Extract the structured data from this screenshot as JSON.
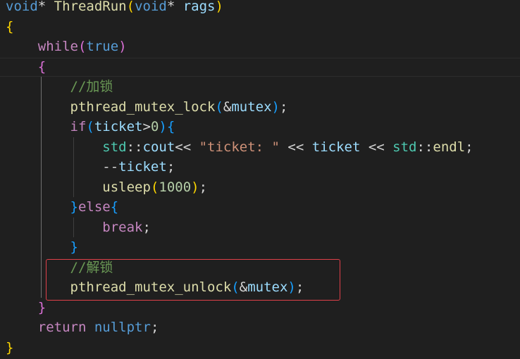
{
  "lines": [
    {
      "tokens": [
        {
          "t": "void",
          "c": "kw-type"
        },
        {
          "t": "* ",
          "c": "plain"
        },
        {
          "t": "ThreadRun",
          "c": "fn"
        },
        {
          "t": "(",
          "c": "b1"
        },
        {
          "t": "void",
          "c": "kw-type"
        },
        {
          "t": "* ",
          "c": "plain"
        },
        {
          "t": "rags",
          "c": "var"
        },
        {
          "t": ")",
          "c": "b1"
        }
      ]
    },
    {
      "tokens": [
        {
          "t": "{",
          "c": "b1"
        }
      ]
    },
    {
      "tokens": [
        {
          "t": "    ",
          "c": "plain"
        },
        {
          "t": "while",
          "c": "kw-ctrl"
        },
        {
          "t": "(",
          "c": "b2"
        },
        {
          "t": "true",
          "c": "kw-type"
        },
        {
          "t": ")",
          "c": "b2"
        }
      ]
    },
    {
      "tokens": [
        {
          "t": "    ",
          "c": "plain"
        },
        {
          "t": "{",
          "c": "b2"
        }
      ]
    },
    {
      "tokens": [
        {
          "t": "        ",
          "c": "plain"
        },
        {
          "t": "//加锁",
          "c": "cmt"
        }
      ]
    },
    {
      "tokens": [
        {
          "t": "        ",
          "c": "plain"
        },
        {
          "t": "pthread_mutex_lock",
          "c": "fn"
        },
        {
          "t": "(",
          "c": "b3"
        },
        {
          "t": "&",
          "c": "plain"
        },
        {
          "t": "mutex",
          "c": "var"
        },
        {
          "t": ")",
          "c": "b3"
        },
        {
          "t": ";",
          "c": "plain"
        }
      ]
    },
    {
      "tokens": [
        {
          "t": "        ",
          "c": "plain"
        },
        {
          "t": "if",
          "c": "kw-ctrl"
        },
        {
          "t": "(",
          "c": "b3"
        },
        {
          "t": "ticket",
          "c": "var"
        },
        {
          "t": ">",
          "c": "plain"
        },
        {
          "t": "0",
          "c": "num"
        },
        {
          "t": ")",
          "c": "b3"
        },
        {
          "t": "{",
          "c": "b3"
        }
      ]
    },
    {
      "tokens": [
        {
          "t": "            ",
          "c": "plain"
        },
        {
          "t": "std",
          "c": "ns"
        },
        {
          "t": "::",
          "c": "plain"
        },
        {
          "t": "cout",
          "c": "var"
        },
        {
          "t": "<< ",
          "c": "plain"
        },
        {
          "t": "\"ticket: \"",
          "c": "str"
        },
        {
          "t": " << ",
          "c": "plain"
        },
        {
          "t": "ticket",
          "c": "var"
        },
        {
          "t": " << ",
          "c": "plain"
        },
        {
          "t": "std",
          "c": "ns"
        },
        {
          "t": "::",
          "c": "plain"
        },
        {
          "t": "endl",
          "c": "fn"
        },
        {
          "t": ";",
          "c": "plain"
        }
      ]
    },
    {
      "tokens": [
        {
          "t": "            ",
          "c": "plain"
        },
        {
          "t": "--",
          "c": "plain"
        },
        {
          "t": "ticket",
          "c": "var"
        },
        {
          "t": ";",
          "c": "plain"
        }
      ]
    },
    {
      "tokens": [
        {
          "t": "            ",
          "c": "plain"
        },
        {
          "t": "usleep",
          "c": "fn"
        },
        {
          "t": "(",
          "c": "b1"
        },
        {
          "t": "1000",
          "c": "num"
        },
        {
          "t": ")",
          "c": "b1"
        },
        {
          "t": ";",
          "c": "plain"
        }
      ]
    },
    {
      "tokens": [
        {
          "t": "        ",
          "c": "plain"
        },
        {
          "t": "}",
          "c": "b3"
        },
        {
          "t": "else",
          "c": "kw-ctrl"
        },
        {
          "t": "{",
          "c": "b3"
        }
      ]
    },
    {
      "tokens": [
        {
          "t": "            ",
          "c": "plain"
        },
        {
          "t": "break",
          "c": "kw-ctrl"
        },
        {
          "t": ";",
          "c": "plain"
        }
      ]
    },
    {
      "tokens": [
        {
          "t": "        ",
          "c": "plain"
        },
        {
          "t": "}",
          "c": "b3"
        }
      ]
    },
    {
      "tokens": [
        {
          "t": "        ",
          "c": "plain"
        },
        {
          "t": "//解锁",
          "c": "cmt"
        }
      ]
    },
    {
      "tokens": [
        {
          "t": "        ",
          "c": "plain"
        },
        {
          "t": "pthread_mutex_unlock",
          "c": "fn"
        },
        {
          "t": "(",
          "c": "b3"
        },
        {
          "t": "&",
          "c": "plain"
        },
        {
          "t": "mutex",
          "c": "var"
        },
        {
          "t": ")",
          "c": "b3"
        },
        {
          "t": ";",
          "c": "plain"
        }
      ]
    },
    {
      "tokens": [
        {
          "t": "    ",
          "c": "plain"
        },
        {
          "t": "}",
          "c": "b2"
        }
      ]
    },
    {
      "tokens": [
        {
          "t": "    ",
          "c": "plain"
        },
        {
          "t": "return",
          "c": "kw-ctrl"
        },
        {
          "t": " ",
          "c": "plain"
        },
        {
          "t": "nullptr",
          "c": "kw-type"
        },
        {
          "t": ";",
          "c": "plain"
        }
      ]
    },
    {
      "tokens": [
        {
          "t": "}",
          "c": "b1"
        }
      ]
    }
  ],
  "current_line_index": 3,
  "highlighted_lines": [
    13,
    14
  ]
}
